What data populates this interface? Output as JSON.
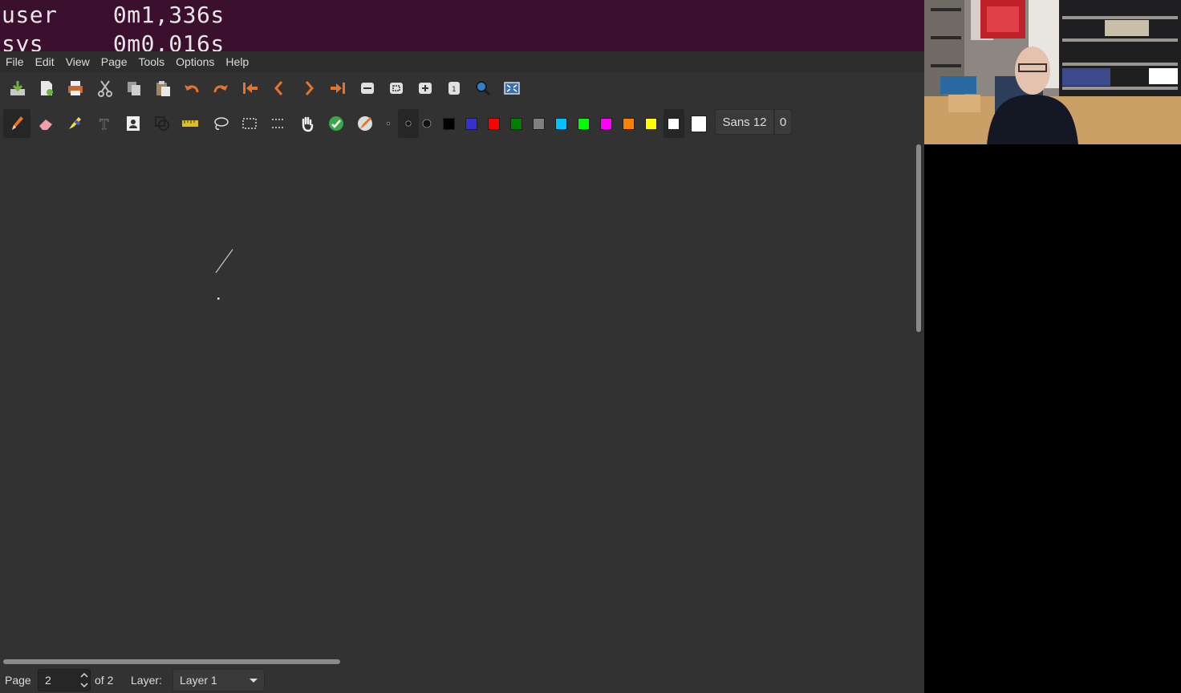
{
  "terminal": {
    "lines": [
      "user    0m1,336s",
      "sys     0m0,016s"
    ]
  },
  "menubar": {
    "items": [
      "File",
      "Edit",
      "View",
      "Page",
      "Tools",
      "Options",
      "Help"
    ]
  },
  "toolbar1": {
    "icons": [
      "save-icon",
      "new-page-icon",
      "print-icon",
      "cut-icon",
      "copy-icon",
      "paste-icon",
      "undo-icon",
      "redo-icon",
      "first-page-icon",
      "previous-page-icon",
      "next-page-icon",
      "last-page-icon",
      "zoom-out-icon",
      "zoom-fit-icon",
      "zoom-in-icon",
      "zoom-100-icon",
      "zoom-search-icon",
      "fullscreen-icon"
    ]
  },
  "toolbar2": {
    "tools": [
      "pen-icon",
      "eraser-icon",
      "highlighter-icon",
      "text-icon",
      "image-icon",
      "shape-recognizer-icon",
      "ruler-icon",
      "lasso-select-icon",
      "rectangle-select-icon",
      "vertical-space-icon",
      "hand-icon",
      "default-tools-icon",
      "pen-settings-icon"
    ],
    "active_tool": "pen-icon",
    "thickness": [
      "fine",
      "medium",
      "thick"
    ],
    "active_thickness": "medium",
    "colors": [
      "#000000",
      "#3333cc",
      "#ff0000",
      "#008000",
      "#808080",
      "#00c0ff",
      "#00ff00",
      "#ff00ff",
      "#ff8000",
      "#ffff00",
      "#ffffff"
    ],
    "active_color": "#ffffff",
    "custom_color": "#ffffff",
    "font_label": "Sans 12",
    "font_extra": "0"
  },
  "statusbar": {
    "page_label": "Page",
    "page_value": "2",
    "page_of": "of 2",
    "layer_label": "Layer:",
    "layer_value": "Layer 1"
  }
}
